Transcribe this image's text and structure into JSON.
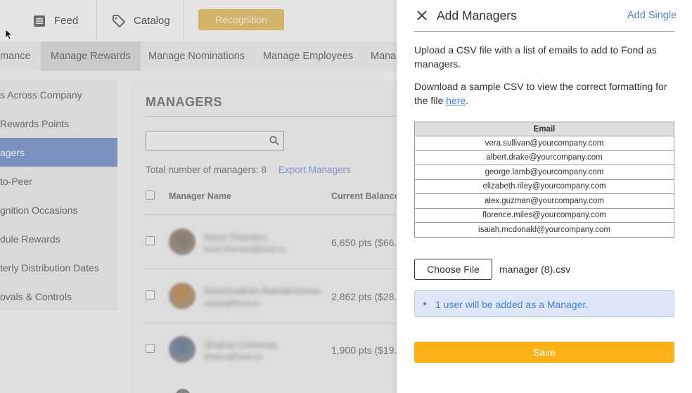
{
  "topnav": {
    "feed_label": "Feed",
    "catalog_label": "Catalog",
    "recognition_label": "Recognition"
  },
  "subnav": {
    "tabs": [
      "mance",
      "Manage Rewards",
      "Manage Nominations",
      "Manage Employees",
      "Mana"
    ]
  },
  "sidebar": {
    "items": [
      "s Across Company",
      "Rewards Points",
      "agers",
      "to-Peer",
      "gnition Occasions",
      "dule Rewards",
      "terly Distribution Dates",
      "ovals & Controls"
    ],
    "active_index": 2
  },
  "managers": {
    "title": "MANAGERS",
    "total_label": "Total number of managers: 8",
    "export_label": "Export Managers",
    "col_name": "Manager Name",
    "col_balance": "Current Balance",
    "rows": [
      {
        "name": "Kevin Thornton",
        "email": "kevin.thornton@fond.co",
        "points": "6,650 pts ($66.",
        "avatar_color": "#8a7a6a"
      },
      {
        "name": "Swaminathan Ramakrishnan",
        "email": "swami@fond.co",
        "points": "2,862 pts ($28.",
        "avatar_color": "#c08a4a"
      },
      {
        "name": "Shalina Contreras",
        "email": "shalina@fond.co",
        "points": "1,900 pts ($19.0",
        "avatar_color": "#6a7a9a"
      }
    ]
  },
  "panel": {
    "title": "Add Managers",
    "add_single_label": "Add Single",
    "upload_text": "Upload a CSV file with a list of emails to add to Fond as managers.",
    "download_text_before": "Download a sample CSV to view the correct formatting for the file ",
    "download_link": "here",
    "download_text_after": ".",
    "table_header": "Email",
    "emails": [
      "vera.sullivan@yourcompany.com",
      "albert.drake@yourcompany.com",
      "george.lamb@yourcompany.com",
      "elizabeth.riley@yourcompany.com",
      "alex.guzman@yourcompany.com",
      "florence.miles@yourcompany.com",
      "isaiah.mcdonald@yourcompany.com"
    ],
    "choose_file_label": "Choose File",
    "file_name": "manager (8).csv",
    "info_message": "1 user will be added as a Manager.",
    "save_label": "Save"
  },
  "colors": {
    "accent_blue": "#4a7fd4",
    "save_yellow": "#fbb117",
    "recognition_gold": "#dcb86a",
    "sidebar_active": "#7c94c4"
  }
}
